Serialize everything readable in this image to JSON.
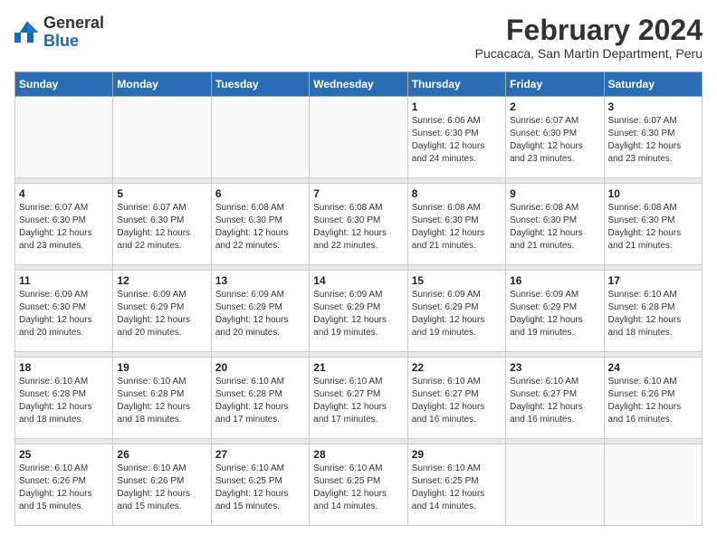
{
  "logo": {
    "general": "General",
    "blue": "Blue"
  },
  "header": {
    "title": "February 2024",
    "subtitle": "Pucacaca, San Martin Department, Peru"
  },
  "days_of_week": [
    "Sunday",
    "Monday",
    "Tuesday",
    "Wednesday",
    "Thursday",
    "Friday",
    "Saturday"
  ],
  "weeks": [
    [
      {
        "day": "",
        "info": ""
      },
      {
        "day": "",
        "info": ""
      },
      {
        "day": "",
        "info": ""
      },
      {
        "day": "",
        "info": ""
      },
      {
        "day": "1",
        "info": "Sunrise: 6:06 AM\nSunset: 6:30 PM\nDaylight: 12 hours and 24 minutes."
      },
      {
        "day": "2",
        "info": "Sunrise: 6:07 AM\nSunset: 6:30 PM\nDaylight: 12 hours and 23 minutes."
      },
      {
        "day": "3",
        "info": "Sunrise: 6:07 AM\nSunset: 6:30 PM\nDaylight: 12 hours and 23 minutes."
      }
    ],
    [
      {
        "day": "4",
        "info": "Sunrise: 6:07 AM\nSunset: 6:30 PM\nDaylight: 12 hours and 23 minutes."
      },
      {
        "day": "5",
        "info": "Sunrise: 6:07 AM\nSunset: 6:30 PM\nDaylight: 12 hours and 22 minutes."
      },
      {
        "day": "6",
        "info": "Sunrise: 6:08 AM\nSunset: 6:30 PM\nDaylight: 12 hours and 22 minutes."
      },
      {
        "day": "7",
        "info": "Sunrise: 6:08 AM\nSunset: 6:30 PM\nDaylight: 12 hours and 22 minutes."
      },
      {
        "day": "8",
        "info": "Sunrise: 6:08 AM\nSunset: 6:30 PM\nDaylight: 12 hours and 21 minutes."
      },
      {
        "day": "9",
        "info": "Sunrise: 6:08 AM\nSunset: 6:30 PM\nDaylight: 12 hours and 21 minutes."
      },
      {
        "day": "10",
        "info": "Sunrise: 6:08 AM\nSunset: 6:30 PM\nDaylight: 12 hours and 21 minutes."
      }
    ],
    [
      {
        "day": "11",
        "info": "Sunrise: 6:09 AM\nSunset: 6:30 PM\nDaylight: 12 hours and 20 minutes."
      },
      {
        "day": "12",
        "info": "Sunrise: 6:09 AM\nSunset: 6:29 PM\nDaylight: 12 hours and 20 minutes."
      },
      {
        "day": "13",
        "info": "Sunrise: 6:09 AM\nSunset: 6:29 PM\nDaylight: 12 hours and 20 minutes."
      },
      {
        "day": "14",
        "info": "Sunrise: 6:09 AM\nSunset: 6:29 PM\nDaylight: 12 hours and 19 minutes."
      },
      {
        "day": "15",
        "info": "Sunrise: 6:09 AM\nSunset: 6:29 PM\nDaylight: 12 hours and 19 minutes."
      },
      {
        "day": "16",
        "info": "Sunrise: 6:09 AM\nSunset: 6:29 PM\nDaylight: 12 hours and 19 minutes."
      },
      {
        "day": "17",
        "info": "Sunrise: 6:10 AM\nSunset: 6:28 PM\nDaylight: 12 hours and 18 minutes."
      }
    ],
    [
      {
        "day": "18",
        "info": "Sunrise: 6:10 AM\nSunset: 6:28 PM\nDaylight: 12 hours and 18 minutes."
      },
      {
        "day": "19",
        "info": "Sunrise: 6:10 AM\nSunset: 6:28 PM\nDaylight: 12 hours and 18 minutes."
      },
      {
        "day": "20",
        "info": "Sunrise: 6:10 AM\nSunset: 6:28 PM\nDaylight: 12 hours and 17 minutes."
      },
      {
        "day": "21",
        "info": "Sunrise: 6:10 AM\nSunset: 6:27 PM\nDaylight: 12 hours and 17 minutes."
      },
      {
        "day": "22",
        "info": "Sunrise: 6:10 AM\nSunset: 6:27 PM\nDaylight: 12 hours and 16 minutes."
      },
      {
        "day": "23",
        "info": "Sunrise: 6:10 AM\nSunset: 6:27 PM\nDaylight: 12 hours and 16 minutes."
      },
      {
        "day": "24",
        "info": "Sunrise: 6:10 AM\nSunset: 6:26 PM\nDaylight: 12 hours and 16 minutes."
      }
    ],
    [
      {
        "day": "25",
        "info": "Sunrise: 6:10 AM\nSunset: 6:26 PM\nDaylight: 12 hours and 15 minutes."
      },
      {
        "day": "26",
        "info": "Sunrise: 6:10 AM\nSunset: 6:26 PM\nDaylight: 12 hours and 15 minutes."
      },
      {
        "day": "27",
        "info": "Sunrise: 6:10 AM\nSunset: 6:25 PM\nDaylight: 12 hours and 15 minutes."
      },
      {
        "day": "28",
        "info": "Sunrise: 6:10 AM\nSunset: 6:25 PM\nDaylight: 12 hours and 14 minutes."
      },
      {
        "day": "29",
        "info": "Sunrise: 6:10 AM\nSunset: 6:25 PM\nDaylight: 12 hours and 14 minutes."
      },
      {
        "day": "",
        "info": ""
      },
      {
        "day": "",
        "info": ""
      }
    ]
  ]
}
